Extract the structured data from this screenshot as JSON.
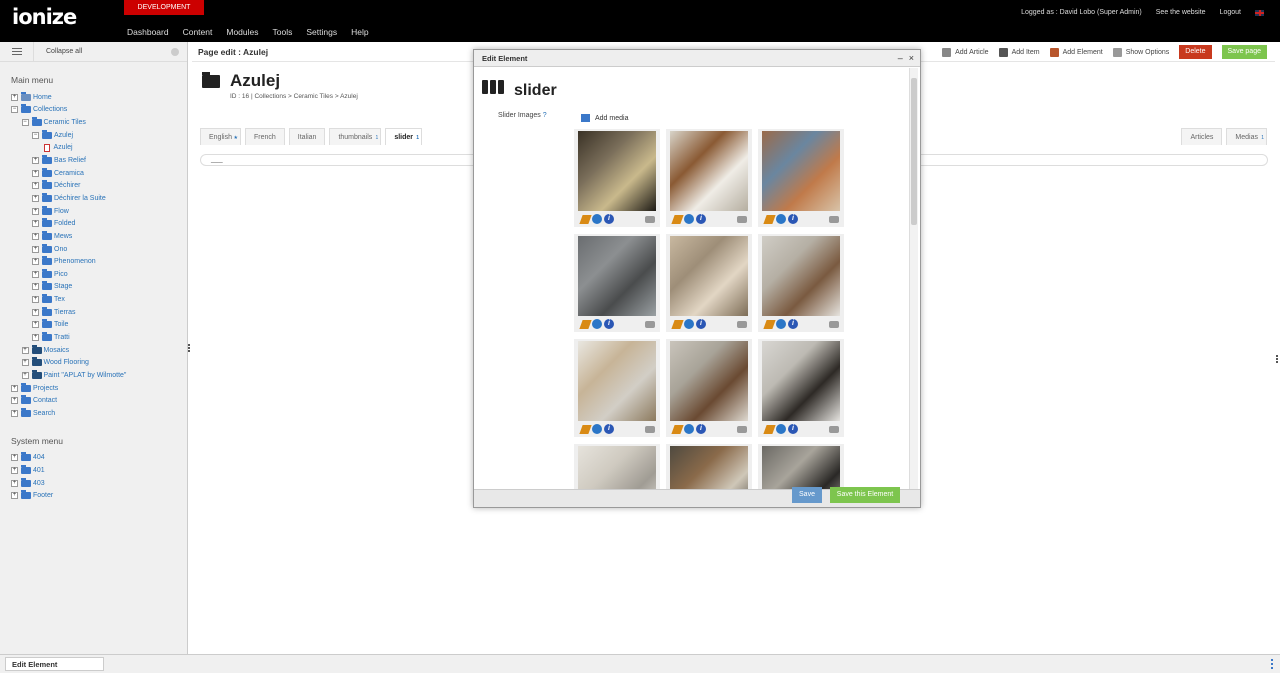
{
  "app": {
    "logo": "ionize",
    "environment": "DEVELOPMENT",
    "nav": [
      "Dashboard",
      "Content",
      "Modules",
      "Tools",
      "Settings",
      "Help"
    ],
    "user": "Logged as : David Lobo (Super Admin)",
    "see_website": "See the website",
    "logout": "Logout"
  },
  "sidebar": {
    "collapse_label": "Collapse all",
    "main_menu_title": "Main menu",
    "main_menu": [
      {
        "label": "Home",
        "level": 0,
        "kind": "home"
      },
      {
        "label": "Collections",
        "level": 0,
        "kind": "open"
      },
      {
        "label": "Ceramic Tiles",
        "level": 1,
        "kind": "open"
      },
      {
        "label": "Azulej",
        "level": 2,
        "kind": "open"
      },
      {
        "label": "Azulej",
        "level": 3,
        "kind": "page"
      },
      {
        "label": "Bas Relief",
        "level": 2,
        "kind": "folder"
      },
      {
        "label": "Ceramica",
        "level": 2,
        "kind": "folder"
      },
      {
        "label": "Déchirer",
        "level": 2,
        "kind": "folder"
      },
      {
        "label": "Déchirer la Suite",
        "level": 2,
        "kind": "folder"
      },
      {
        "label": "Flow",
        "level": 2,
        "kind": "folder"
      },
      {
        "label": "Folded",
        "level": 2,
        "kind": "folder"
      },
      {
        "label": "Mews",
        "level": 2,
        "kind": "folder"
      },
      {
        "label": "Ono",
        "level": 2,
        "kind": "folder"
      },
      {
        "label": "Phenomenon",
        "level": 2,
        "kind": "folder"
      },
      {
        "label": "Pico",
        "level": 2,
        "kind": "folder"
      },
      {
        "label": "Stage",
        "level": 2,
        "kind": "folder"
      },
      {
        "label": "Tex",
        "level": 2,
        "kind": "folder"
      },
      {
        "label": "Tierras",
        "level": 2,
        "kind": "folder"
      },
      {
        "label": "Toile",
        "level": 2,
        "kind": "folder"
      },
      {
        "label": "Tratti",
        "level": 2,
        "kind": "folder"
      },
      {
        "label": "Mosaics",
        "level": 1,
        "kind": "folder"
      },
      {
        "label": "Wood Flooring",
        "level": 1,
        "kind": "folder"
      },
      {
        "label": "Paint \"APLAT by Wilmotte\"",
        "level": 1,
        "kind": "folder"
      },
      {
        "label": "Projects",
        "level": 0,
        "kind": "folder"
      },
      {
        "label": "Contact",
        "level": 0,
        "kind": "folder"
      },
      {
        "label": "Search",
        "level": 0,
        "kind": "folder"
      }
    ],
    "system_menu_title": "System menu",
    "system_menu": [
      {
        "label": "404",
        "level": 0,
        "kind": "folder"
      },
      {
        "label": "401",
        "level": 0,
        "kind": "folder"
      },
      {
        "label": "403",
        "level": 0,
        "kind": "folder"
      },
      {
        "label": "Footer",
        "level": 0,
        "kind": "folder"
      }
    ]
  },
  "page": {
    "header": "Page edit : Azulej",
    "title": "Azulej",
    "breadcrumb": "ID : 16 | Collections > Ceramic Tiles > Azulej",
    "toolbar": {
      "add_article": "Add Article",
      "add_item": "Add Item",
      "add_element": "Add Element",
      "show_options": "Show Options",
      "delete": "Delete",
      "save_page": "Save page"
    },
    "tabs": [
      {
        "label": "English",
        "badge": "★",
        "active": false
      },
      {
        "label": "French",
        "badge": "",
        "active": false
      },
      {
        "label": "Italian",
        "badge": "",
        "active": false
      },
      {
        "label": "thumbnails",
        "badge": "1",
        "active": false
      },
      {
        "label": "slider",
        "badge": "1",
        "active": true
      }
    ],
    "right_tabs": [
      {
        "label": "Articles",
        "badge": ""
      },
      {
        "label": "Medias",
        "badge": "1"
      }
    ],
    "content_placeholder": "___"
  },
  "modal": {
    "header": "Edit Element",
    "title": "slider",
    "field_label": "Slider Images",
    "help": "?",
    "add_media": "Add media",
    "save": "Save",
    "save_element": "Save this Element",
    "images": [
      {
        "colors": [
          "#3a3226",
          "#7a6e5a",
          "#c9b98c",
          "#1d1a15"
        ]
      },
      {
        "colors": [
          "#d8d4c9",
          "#8a5a34",
          "#efece6",
          "#b5aea0"
        ]
      },
      {
        "colors": [
          "#9a6a4a",
          "#6a86a0",
          "#c07a4a",
          "#d8c3a8"
        ]
      },
      {
        "colors": [
          "#6a6d70",
          "#8c8f91",
          "#4a4c4d",
          "#9aa0a3"
        ]
      },
      {
        "colors": [
          "#c8b8a0",
          "#9e8e78",
          "#e2d6c4",
          "#7d6d57"
        ]
      },
      {
        "colors": [
          "#d0cdc6",
          "#b5afa4",
          "#7a5a40",
          "#e6e3de"
        ]
      },
      {
        "colors": [
          "#e9e7e1",
          "#c7b497",
          "#d2cec6",
          "#8c7a5e"
        ]
      },
      {
        "colors": [
          "#c9c4bb",
          "#a8a398",
          "#6a4a32",
          "#ded9d0"
        ]
      },
      {
        "colors": [
          "#d8d6d2",
          "#bdbab3",
          "#2e2a26",
          "#e5e3df"
        ]
      },
      {
        "colors": [
          "#e6e3dc",
          "#cfcac0",
          "#a09c94",
          "#f0eee9"
        ]
      },
      {
        "colors": [
          "#4f4a40",
          "#8a6a4a",
          "#cfc7b8",
          "#2d2a25"
        ]
      },
      {
        "colors": [
          "#6b6964",
          "#a8a49b",
          "#2a2826",
          "#d3cfc6"
        ]
      }
    ]
  },
  "statusbar": {
    "tab": "Edit Element"
  },
  "colors": {
    "topbar": "#000000",
    "env": "#cc0000",
    "link": "#2a73b8",
    "delete": "#c8391e",
    "save_page": "#7dc54e",
    "save": "#6699cc"
  }
}
